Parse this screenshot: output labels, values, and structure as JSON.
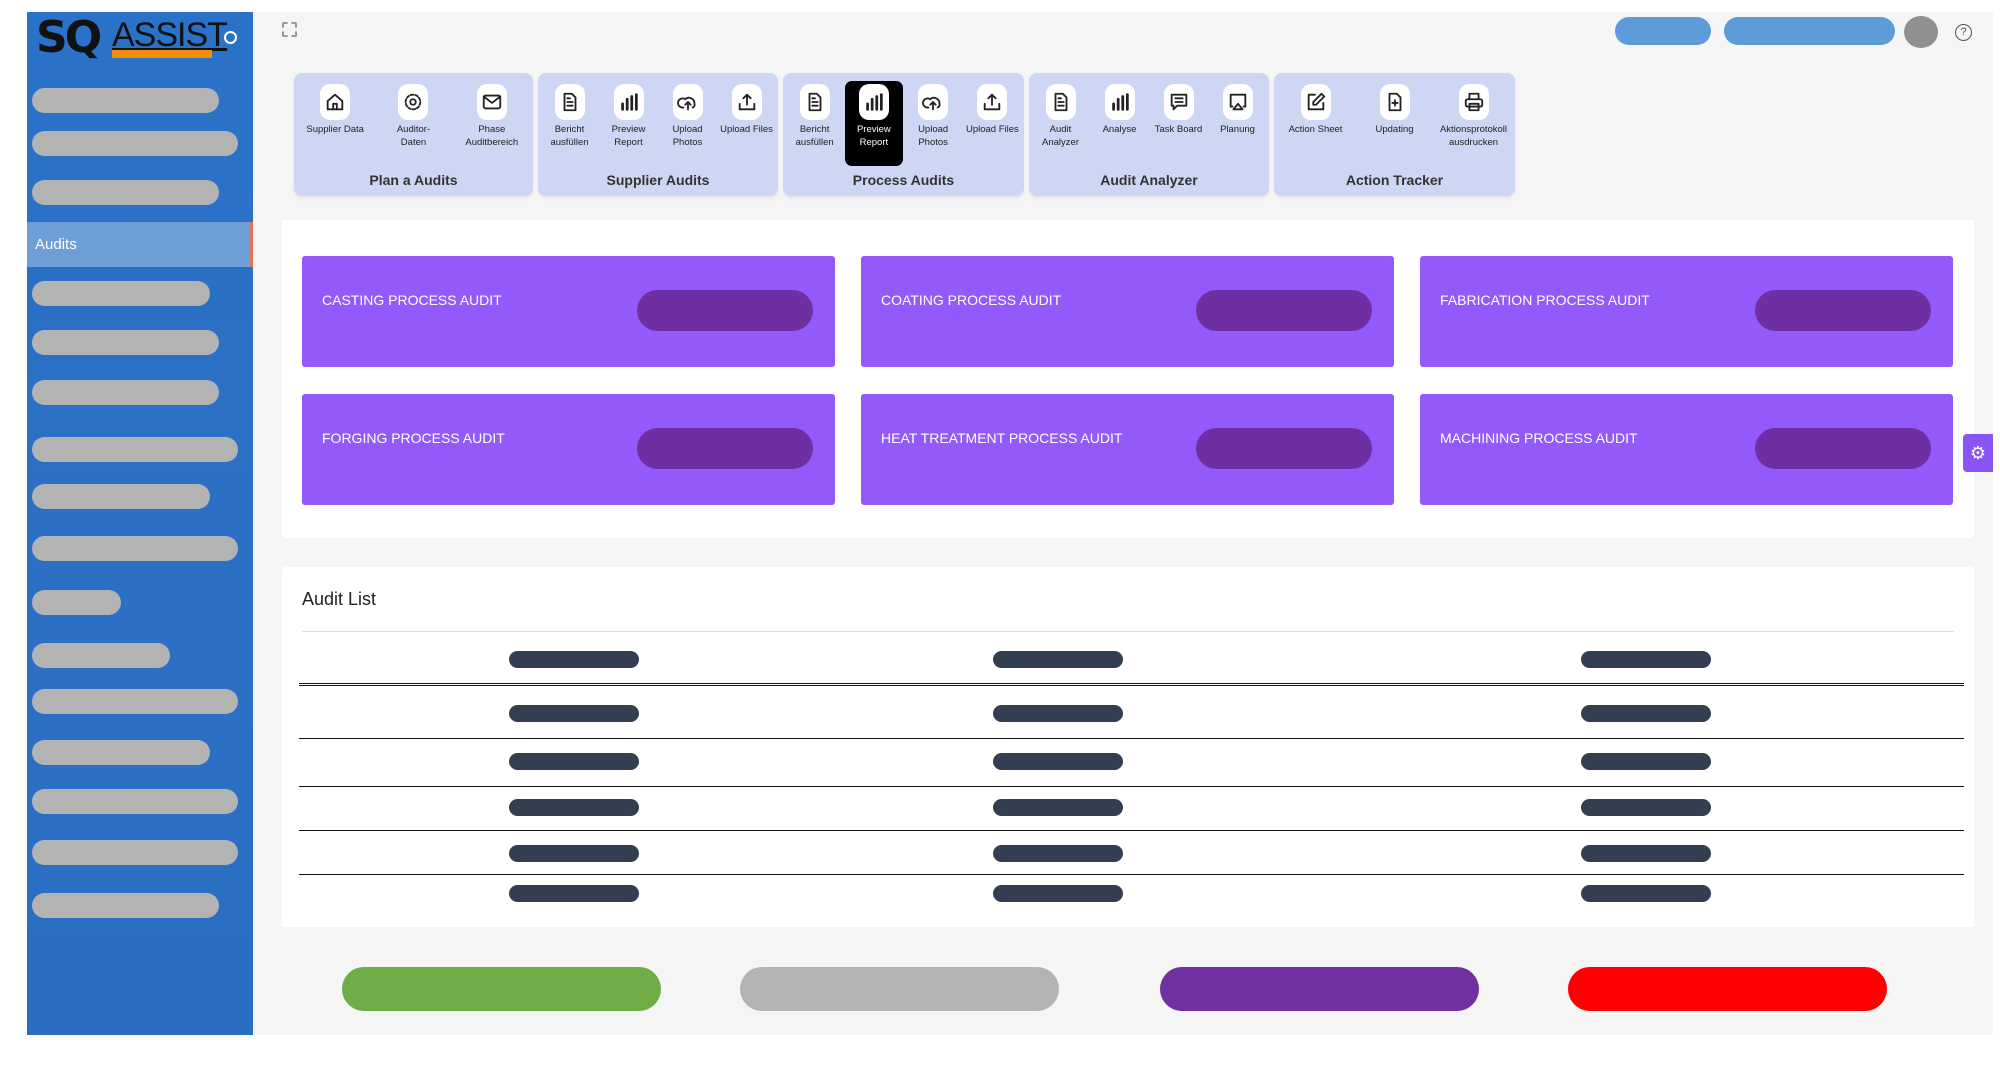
{
  "app": {
    "logo_text_bold": "SQ",
    "logo_text": "ASSIST"
  },
  "sidebar": {
    "active_item": "Audits",
    "placeholder_count_above": 3,
    "placeholder_count_below": 13
  },
  "toolbar": {
    "groups": [
      {
        "title": "Plan a Audits",
        "items": [
          {
            "label": "Supplier Data",
            "icon": "home-icon"
          },
          {
            "label": "Auditor-Daten",
            "icon": "gear-icon"
          },
          {
            "label": "Phase Auditbereich",
            "icon": "mail-icon"
          }
        ]
      },
      {
        "title": "Supplier Audits",
        "items": [
          {
            "label": "Bericht ausfüllen",
            "icon": "document-icon"
          },
          {
            "label": "Preview Report",
            "icon": "bar-chart-icon"
          },
          {
            "label": "Upload Photos",
            "icon": "cloud-upload-icon"
          },
          {
            "label": "Upload Files",
            "icon": "upload-icon"
          }
        ]
      },
      {
        "title": "Process Audits",
        "items": [
          {
            "label": "Bericht ausfüllen",
            "icon": "document-icon"
          },
          {
            "label": "Preview Report",
            "icon": "bar-chart-icon",
            "active": true
          },
          {
            "label": "Upload Photos",
            "icon": "cloud-upload-icon"
          },
          {
            "label": "Upload Files",
            "icon": "upload-icon"
          }
        ]
      },
      {
        "title": "Audit Analyzer",
        "items": [
          {
            "label": "Audit Analyzer",
            "icon": "document-icon"
          },
          {
            "label": "Analyse",
            "icon": "bar-chart-icon"
          },
          {
            "label": "Task Board",
            "icon": "message-icon"
          },
          {
            "label": "Planung",
            "icon": "airplay-icon"
          }
        ]
      },
      {
        "title": "Action Tracker",
        "items": [
          {
            "label": "Action Sheet",
            "icon": "edit-icon"
          },
          {
            "label": "Updating",
            "icon": "file-plus-icon"
          },
          {
            "label": "Aktionsprotokoll ausdrucken",
            "icon": "printer-icon"
          }
        ]
      }
    ]
  },
  "cards": [
    {
      "title": "CASTING PROCESS AUDIT"
    },
    {
      "title": "COATING PROCESS AUDIT"
    },
    {
      "title": "FABRICATION PROCESS AUDIT"
    },
    {
      "title": "FORGING PROCESS AUDIT"
    },
    {
      "title": "HEAT TREATMENT PROCESS AUDIT"
    },
    {
      "title": "MACHINING PROCESS AUDIT"
    }
  ],
  "audit_list": {
    "title": "Audit List",
    "rows": 6,
    "columns": 3
  },
  "colors": {
    "sidebar": "#2a72c8",
    "card": "#9359fb",
    "card_pill": "#6f2ea2",
    "toolbar_group": "#cdd6f3",
    "top_pill": "#5a9bd8",
    "btn_green": "#6fad46",
    "btn_gray": "#b3b3b3",
    "btn_purple": "#7030a0",
    "btn_red": "#ff0000"
  },
  "footer_buttons": [
    {
      "color": "#6fad46"
    },
    {
      "color": "#b3b3b3"
    },
    {
      "color": "#7030a0"
    },
    {
      "color": "#ff0000"
    }
  ]
}
